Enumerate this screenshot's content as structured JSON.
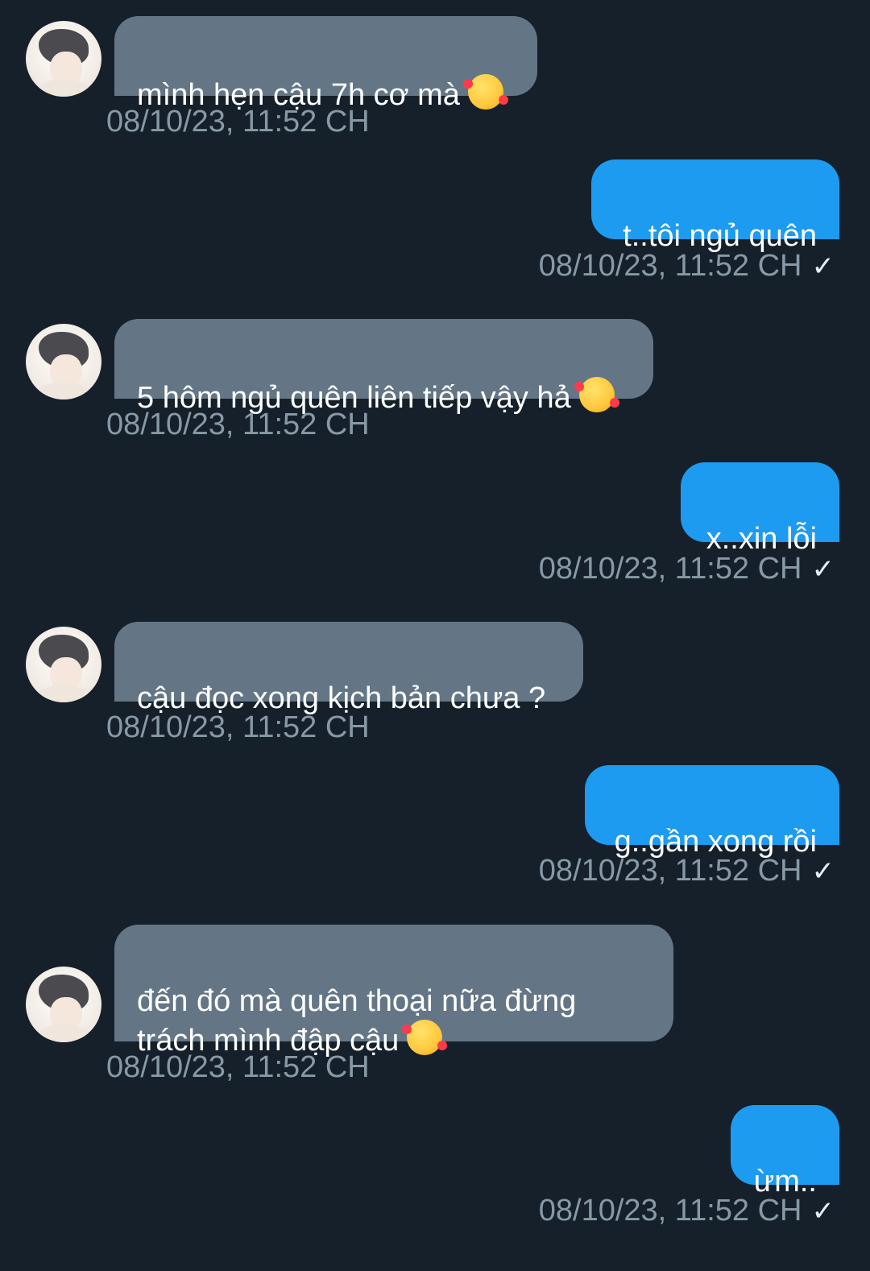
{
  "messages": [
    {
      "side": "in",
      "text": "mình hẹn cậu 7h cơ mà",
      "emoji": "smiling-face-with-hearts-icon",
      "time": "08/10/23, 11:52 CH"
    },
    {
      "side": "out",
      "text": "t..tôi ngủ quên",
      "time": "08/10/23, 11:52 CH",
      "read": "✓"
    },
    {
      "side": "in",
      "text": "5 hôm ngủ quên liên tiếp vậy hả",
      "emoji": "smiling-face-with-hearts-icon",
      "time": "08/10/23, 11:52 CH"
    },
    {
      "side": "out",
      "text": "x..xin lỗi",
      "time": "08/10/23, 11:52 CH",
      "read": "✓"
    },
    {
      "side": "in",
      "text": "cậu đọc xong kịch bản chưa ?",
      "time": "08/10/23, 11:52 CH"
    },
    {
      "side": "out",
      "text": "g..gần xong rồi",
      "time": "08/10/23, 11:52 CH",
      "read": "✓"
    },
    {
      "side": "in",
      "text": "đến đó mà quên thoại nữa đừng\ntrách mình đập cậu",
      "emoji": "smiling-face-with-hearts-icon",
      "time": "08/10/23, 11:52 CH"
    },
    {
      "side": "out",
      "text": "ừm..",
      "time": "08/10/23, 11:52 CH",
      "read": "✓"
    }
  ],
  "colors": {
    "background": "#15202b",
    "incoming_bubble": "#647686",
    "outgoing_bubble": "#1d9bf0",
    "timestamp": "#8899a6"
  }
}
